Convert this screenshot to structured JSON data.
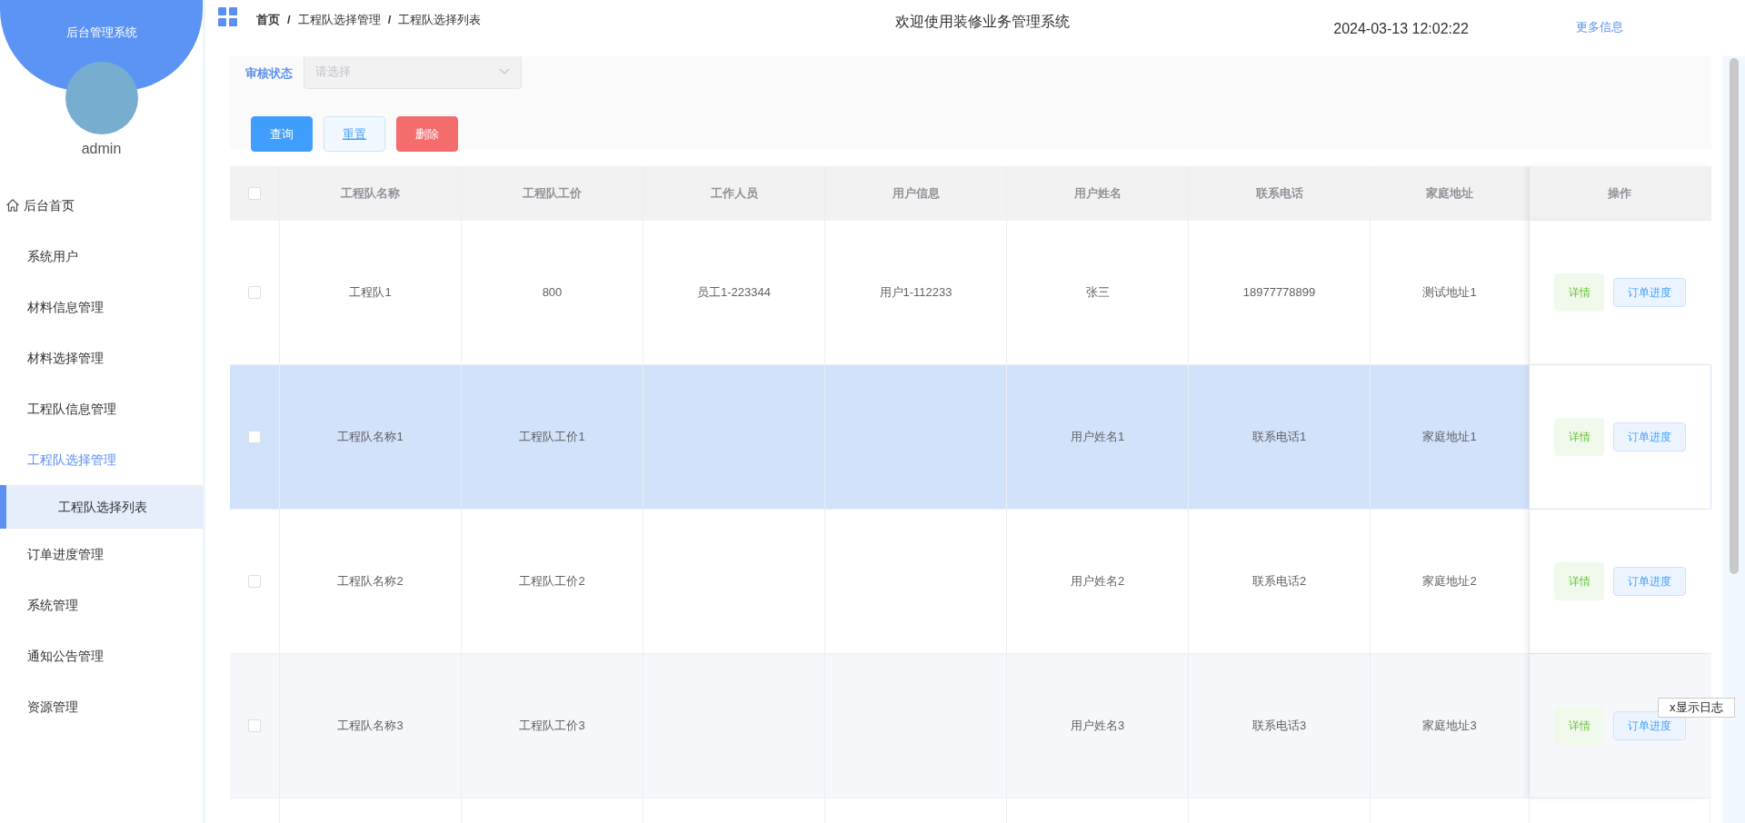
{
  "sidebar": {
    "title": "后台管理系统",
    "user": "admin",
    "items": [
      {
        "label": "后台首页",
        "kind": "home",
        "expanded": false,
        "selected": false
      },
      {
        "label": "系统用户",
        "kind": "plain",
        "expanded": false,
        "selected": false
      },
      {
        "label": "材料信息管理",
        "kind": "plain",
        "expanded": false,
        "selected": false
      },
      {
        "label": "材料选择管理",
        "kind": "plain",
        "expanded": false,
        "selected": false
      },
      {
        "label": "工程队信息管理",
        "kind": "plain",
        "expanded": false,
        "selected": false
      },
      {
        "label": "工程队选择管理",
        "kind": "plain",
        "expanded": true,
        "selected": false,
        "children": [
          {
            "label": "工程队选择列表",
            "selected": true
          }
        ]
      },
      {
        "label": "订单进度管理",
        "kind": "plain",
        "expanded": false,
        "selected": false
      },
      {
        "label": "系统管理",
        "kind": "plain",
        "expanded": false,
        "selected": false
      },
      {
        "label": "通知公告管理",
        "kind": "plain",
        "expanded": false,
        "selected": false
      },
      {
        "label": "资源管理",
        "kind": "plain",
        "expanded": false,
        "selected": false
      }
    ]
  },
  "header": {
    "breadcrumb": [
      "首页",
      "工程队选择管理",
      "工程队选择列表"
    ],
    "separator": "/",
    "title": "欢迎使用装修业务管理系统",
    "datetime": "2024-03-13 12:02:22",
    "more_link": "更多信息"
  },
  "filter": {
    "label": "审核状态",
    "select": {
      "placeholder": "请选择"
    },
    "buttons": [
      {
        "label": "查询",
        "kind": "primary"
      },
      {
        "label": "重置",
        "kind": "plain"
      },
      {
        "label": "删除",
        "kind": "danger"
      }
    ]
  },
  "table": {
    "select_all": {
      "checked": false
    },
    "columns": [
      "工程队名称",
      "工程队工价",
      "工作人员",
      "用户信息",
      "用户姓名",
      "联系电话",
      "家庭地址",
      "操作"
    ],
    "rows": [
      {
        "checked": false,
        "hovered": false,
        "team_name": "工程队1",
        "team_price": "800",
        "staff": "员工1-223344",
        "user_info": "用户1-112233",
        "user_name": "张三",
        "phone": "18977778899",
        "address": "测试地址1",
        "actions": [
          {
            "label": "详情",
            "kind": "success"
          },
          {
            "label": "订单进度",
            "kind": "primary"
          }
        ]
      },
      {
        "checked": false,
        "hovered": true,
        "team_name": "工程队名称1",
        "team_price": "工程队工价1",
        "user_name": "用户姓名1",
        "phone": "联系电话1",
        "address": "家庭地址1",
        "actions": [
          {
            "label": "详情",
            "kind": "success"
          },
          {
            "label": "订单进度",
            "kind": "primary"
          }
        ]
      },
      {
        "checked": false,
        "hovered": false,
        "team_name": "工程队名称2",
        "team_price": "工程队工价2",
        "user_name": "用户姓名2",
        "phone": "联系电话2",
        "address": "家庭地址2",
        "actions": [
          {
            "label": "详情",
            "kind": "success"
          },
          {
            "label": "订单进度",
            "kind": "primary"
          }
        ]
      },
      {
        "checked": false,
        "hovered": false,
        "team_name": "工程队名称3",
        "team_price": "工程队工价3",
        "user_name": "用户姓名3",
        "phone": "联系电话3",
        "address": "家庭地址3",
        "actions": [
          {
            "label": "详情",
            "kind": "success"
          },
          {
            "label": "订单进度",
            "kind": "primary"
          }
        ]
      }
    ]
  },
  "log_toggle": "x显示日志"
}
